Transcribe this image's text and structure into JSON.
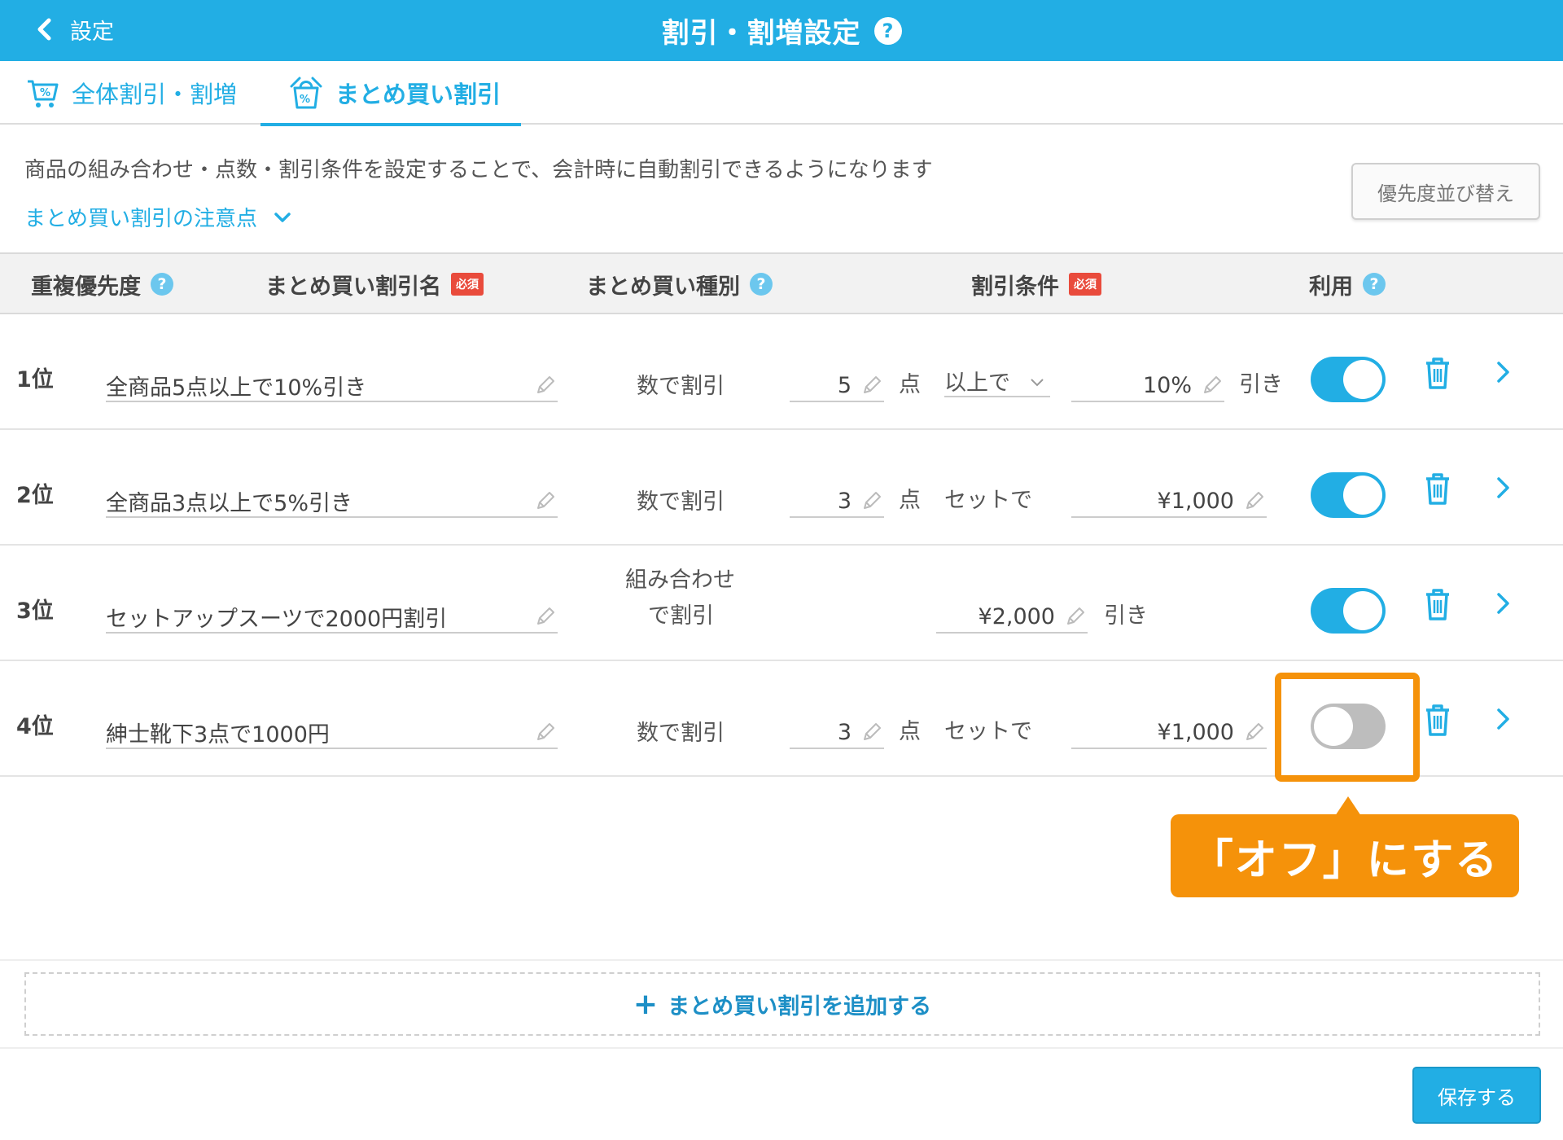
{
  "header": {
    "back_label": "設定",
    "title": "割引・割増設定",
    "help": "?"
  },
  "tabs": [
    {
      "label": "全体割引・割増",
      "active": false
    },
    {
      "label": "まとめ買い割引",
      "active": true
    }
  ],
  "description": "商品の組み合わせ・点数・割引条件を設定することで、会計時に自動割引できるようになります",
  "notes_link": "まとめ買い割引の注意点",
  "sort_button": "優先度並び替え",
  "table_headers": {
    "priority": "重複優先度",
    "name": "まとめ買い割引名",
    "type": "まとめ買い種別",
    "condition": "割引条件",
    "enabled": "利用",
    "required_badge": "必須",
    "help": "?"
  },
  "rows": [
    {
      "rank": "1位",
      "name": "全商品5点以上で10%引き",
      "type": "数で割引",
      "count": "5",
      "unit": "点",
      "mode": "以上で",
      "amount": "10%",
      "suffix": "引き",
      "enabled": true
    },
    {
      "rank": "2位",
      "name": "全商品3点以上で5%引き",
      "type": "数で割引",
      "count": "3",
      "unit": "点",
      "mode": "セットで",
      "amount": "¥1,000",
      "enabled": true
    },
    {
      "rank": "3位",
      "name": "セットアップスーツで2000円割引",
      "type_line1": "組み合わせ",
      "type_line2": "で割引",
      "amount": "¥2,000",
      "suffix": "引き",
      "enabled": true
    },
    {
      "rank": "4位",
      "name": "紳士靴下3点で1000円",
      "type": "数で割引",
      "count": "3",
      "unit": "点",
      "mode": "セットで",
      "amount": "¥1,000",
      "enabled": false
    }
  ],
  "annotation": {
    "callout": "「オフ」にする",
    "color": "#f5920a"
  },
  "add_button": "まとめ買い割引を追加する",
  "add_icon": "+",
  "save_button": "保存する",
  "colors": {
    "primary": "#22aee4",
    "required": "#e94b3c",
    "toggle_off": "#bdbdbd"
  }
}
